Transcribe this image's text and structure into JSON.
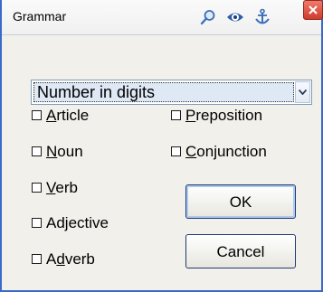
{
  "window": {
    "title": "Grammar"
  },
  "titlebar_icons": [
    "search-icon",
    "eye-icon",
    "anchor-icon",
    "close-icon"
  ],
  "colors": {
    "window_border": "#3b69c9",
    "close_button": "#d9493a",
    "dropdown_highlight": "#dfe8f5"
  },
  "dropdown": {
    "selected": "Number in digits"
  },
  "checkboxes": [
    {
      "pre": "",
      "hot": "A",
      "post": "rticle",
      "checked": false
    },
    {
      "pre": "",
      "hot": "N",
      "post": "oun",
      "checked": false
    },
    {
      "pre": "",
      "hot": "V",
      "post": "erb",
      "checked": false
    },
    {
      "pre": "Ad",
      "hot": "j",
      "post": "ective",
      "checked": false
    },
    {
      "pre": "A",
      "hot": "d",
      "post": "verb",
      "checked": false
    },
    {
      "pre": "",
      "hot": "P",
      "post": "reposition",
      "checked": false
    },
    {
      "pre": "",
      "hot": "C",
      "post": "onjunction",
      "checked": false
    }
  ],
  "buttons": {
    "ok": "OK",
    "cancel": "Cancel"
  }
}
